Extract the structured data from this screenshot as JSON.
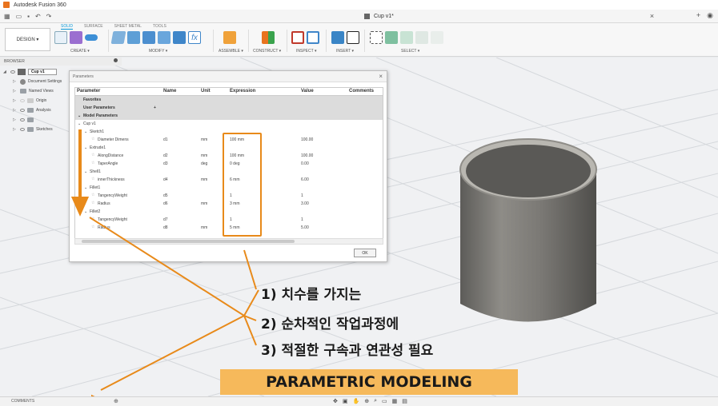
{
  "app": {
    "title": "Autodesk Fusion 360"
  },
  "document": {
    "tab_title": "Cup v1*"
  },
  "quick_access": [
    "grid-icon",
    "file-icon",
    "save-icon",
    "undo-icon",
    "redo-icon"
  ],
  "toolbar": {
    "workspace_label": "DESIGN ▾",
    "tabs": [
      "SOLID",
      "SURFACE",
      "SHEET METAL",
      "TOOLS"
    ],
    "active_tab": "SOLID",
    "groups": [
      {
        "label": "CREATE ▾"
      },
      {
        "label": "MODIFY ▾"
      },
      {
        "label": "ASSEMBLE ▾"
      },
      {
        "label": "CONSTRUCT ▾"
      },
      {
        "label": "INSPECT ▾"
      },
      {
        "label": "INSERT ▾"
      },
      {
        "label": "SELECT ▾"
      }
    ]
  },
  "browser": {
    "title": "BROWSER",
    "root": "Cup v1",
    "items": [
      "Document Settings",
      "Named Views",
      "Origin",
      "Analysis",
      "Sketches"
    ]
  },
  "dialog": {
    "title": "Parameters",
    "columns": [
      "Parameter",
      "Name",
      "Unit",
      "Expression",
      "Value",
      "Comments"
    ],
    "rows": [
      {
        "kind": "group",
        "parameter": "Favorites"
      },
      {
        "kind": "group",
        "parameter": "User Parameters",
        "extra": "+"
      },
      {
        "kind": "group",
        "parameter": "Model Parameters"
      },
      {
        "kind": "node",
        "parameter": "Cup v1"
      },
      {
        "kind": "node",
        "parameter": "Sketch1"
      },
      {
        "kind": "param",
        "parameter": "Diameter Dimens",
        "name": "d1",
        "unit": "mm",
        "expression": "100 mm",
        "value": "100.00"
      },
      {
        "kind": "node",
        "parameter": "Extrude1"
      },
      {
        "kind": "param",
        "parameter": "AlongDistance",
        "name": "d2",
        "unit": "mm",
        "expression": "100 mm",
        "value": "100.00"
      },
      {
        "kind": "param",
        "parameter": "TaperAngle",
        "name": "d3",
        "unit": "deg",
        "expression": "0 deg",
        "value": "0.00"
      },
      {
        "kind": "node",
        "parameter": "Shell1"
      },
      {
        "kind": "param",
        "parameter": "innerThickness",
        "name": "d4",
        "unit": "mm",
        "expression": "6 mm",
        "value": "6.00"
      },
      {
        "kind": "node",
        "parameter": "Fillet1"
      },
      {
        "kind": "param",
        "parameter": "TangencyWeight",
        "name": "d5",
        "unit": "",
        "expression": "1",
        "value": "1"
      },
      {
        "kind": "param",
        "parameter": "Radius",
        "name": "d6",
        "unit": "mm",
        "expression": "3 mm",
        "value": "3.00"
      },
      {
        "kind": "node",
        "parameter": "Fillet2"
      },
      {
        "kind": "param",
        "parameter": "TangencyWeight",
        "name": "d7",
        "unit": "",
        "expression": "1",
        "value": "1"
      },
      {
        "kind": "param",
        "parameter": "Radius",
        "name": "d8",
        "unit": "mm",
        "expression": "5 mm",
        "value": "5.00"
      }
    ],
    "ok_label": "OK"
  },
  "annotations": {
    "line1": "1) 치수를 가지는",
    "line2": "2) 순차적인 작업과정에",
    "line3": "3) 적절한 구속과 연관성 필요",
    "banner": "PARAMETRIC MODELING"
  },
  "bottom": {
    "comments_label": "COMMENTS"
  },
  "colors": {
    "accent": "#0696d7",
    "highlight": "#e88a1a",
    "banner": "#f6b95b",
    "cup": "#7b7a76"
  }
}
